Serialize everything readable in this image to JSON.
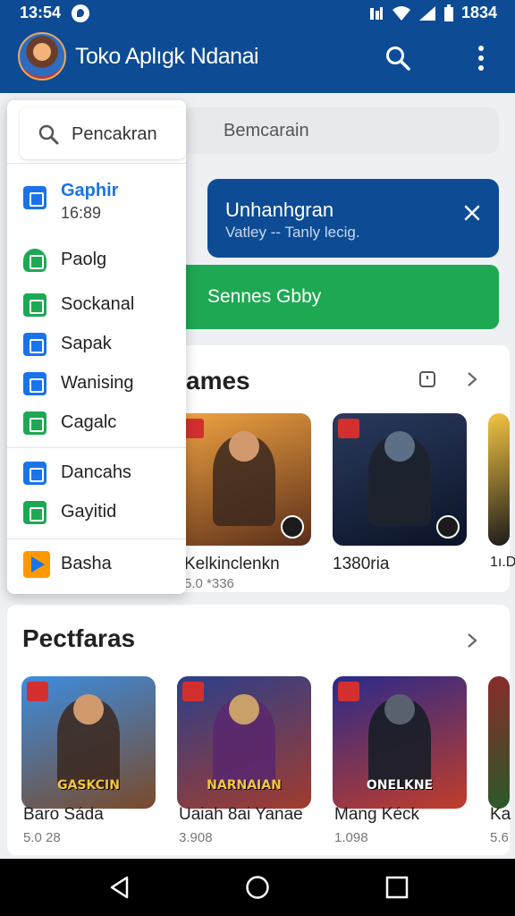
{
  "status_bar": {
    "time_left": "13:54",
    "time_right": "1834"
  },
  "app_bar": {
    "title": "Toko Aplıgk Ndanai"
  },
  "search": {
    "placeholder": "Bemcarain"
  },
  "banner": {
    "title": "Unhanhgran",
    "subtitle": "Vatley -- Tanly lecig."
  },
  "green_button": {
    "label": "Sennes Gbby"
  },
  "drawer": {
    "search_label": "Pencakran",
    "items": [
      {
        "label": "Gaphir",
        "sublabel": "16:89",
        "icon": "grid-icon",
        "color": "#1a73e8"
      },
      {
        "label": "Paolg",
        "icon": "android-icon",
        "color": "#1fa854"
      },
      {
        "label": "Sockanal",
        "icon": "square-icon",
        "color": "#1fa854"
      },
      {
        "label": "Sapak",
        "icon": "key-icon",
        "color": "#1a73e8"
      },
      {
        "label": "Wanising",
        "icon": "box-icon",
        "color": "#1a73e8"
      },
      {
        "label": "Cagalc",
        "icon": "check-icon",
        "color": "#1fa854"
      },
      {
        "label": "Dancahs",
        "icon": "square-icon",
        "color": "#1a73e8"
      },
      {
        "label": "Gayitid",
        "icon": "square-icon",
        "color": "#1fa854"
      },
      {
        "label": "Basha",
        "icon": "play-store-icon",
        "color": "#ff9800"
      }
    ]
  },
  "games_section": {
    "title": "ames",
    "tiles": [
      {
        "name": "Kelkinclenkn",
        "meta": "5.0 *336",
        "colors": [
          "#f0a341",
          "#5a2e1a"
        ]
      },
      {
        "name": "1380ria",
        "meta": "",
        "colors": [
          "#2a3a5e",
          "#0b1326"
        ]
      },
      {
        "name": "1ı.D",
        "meta": "",
        "colors": [
          "#f4c542",
          "#1b1b1b"
        ]
      }
    ]
  },
  "popular_section": {
    "title": "Pectfaras",
    "tiles": [
      {
        "name": "Baro Sáda",
        "meta": "5.0 28",
        "logo": "GASKCIN",
        "colors": [
          "#3c8de0",
          "#7a4a2a"
        ]
      },
      {
        "name": "Uaiah 8ai Yanae",
        "meta": "3.908",
        "logo": "NARNAIAN",
        "colors": [
          "#2d3f8a",
          "#a13c2e"
        ]
      },
      {
        "name": "Mang Kéck",
        "meta": "1.098",
        "logo": "ONELKNE",
        "colors": [
          "#2a2a8a",
          "#c23d2a"
        ]
      },
      {
        "name": "Ka",
        "meta": "5.6",
        "logo": "",
        "colors": [
          "#8a2a2a",
          "#2a5a2a"
        ]
      }
    ]
  }
}
